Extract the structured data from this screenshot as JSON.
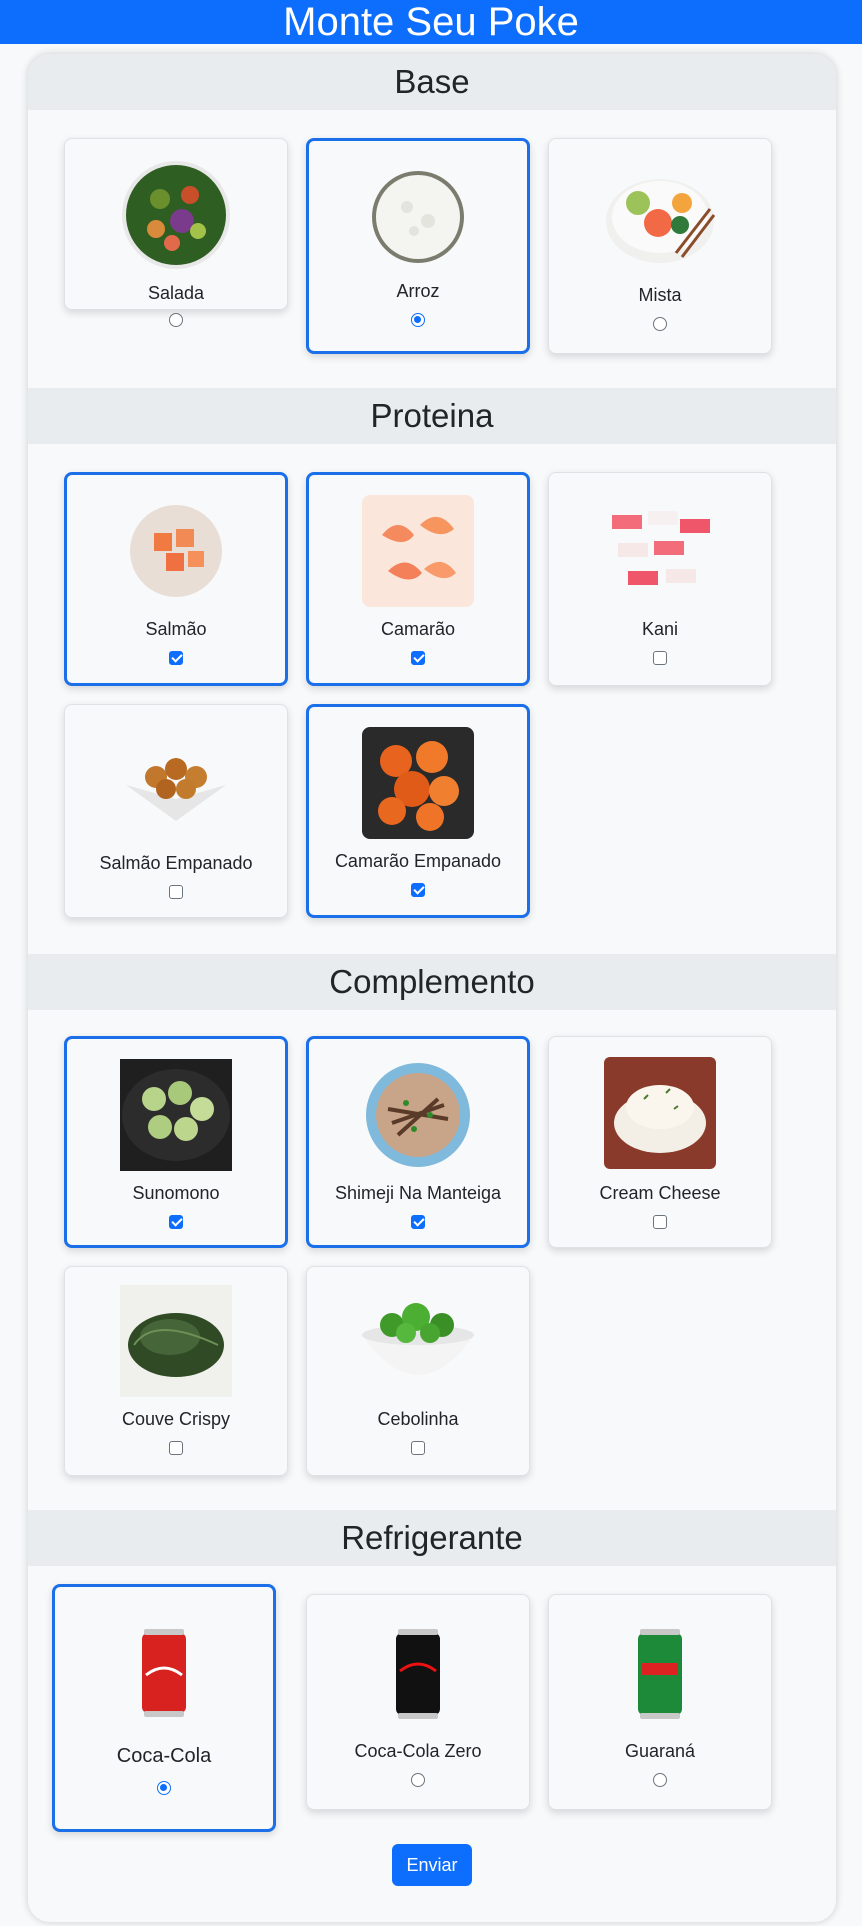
{
  "header": {
    "title": "Monte Seu Poke"
  },
  "sections": {
    "base": {
      "title": "Base",
      "items": [
        {
          "label": "Salada",
          "selected": false
        },
        {
          "label": "Arroz",
          "selected": true
        },
        {
          "label": "Mista",
          "selected": false
        }
      ]
    },
    "proteina": {
      "title": "Proteina",
      "items": [
        {
          "label": "Salmão",
          "selected": true
        },
        {
          "label": "Camarão",
          "selected": true
        },
        {
          "label": "Kani",
          "selected": false
        },
        {
          "label": "Salmão Empanado",
          "selected": false
        },
        {
          "label": "Camarão Empanado",
          "selected": true
        }
      ]
    },
    "complemento": {
      "title": "Complemento",
      "items": [
        {
          "label": "Sunomono",
          "selected": true
        },
        {
          "label": "Shimeji Na Manteiga",
          "selected": true
        },
        {
          "label": "Cream Cheese",
          "selected": false
        },
        {
          "label": "Couve Crispy",
          "selected": false
        },
        {
          "label": "Cebolinha",
          "selected": false
        }
      ]
    },
    "refrigerante": {
      "title": "Refrigerante",
      "items": [
        {
          "label": "Coca-Cola",
          "selected": true
        },
        {
          "label": "Coca-Cola Zero",
          "selected": false
        },
        {
          "label": "Guaraná",
          "selected": false
        }
      ]
    }
  },
  "submit_label": "Enviar",
  "colors": {
    "accent": "#0d6efd",
    "selected_border": "#1b6fe8",
    "section_header": "#e9ecef"
  },
  "icons": {
    "salada": "salad-bowl-icon",
    "arroz": "rice-bowl-icon",
    "mista": "poke-bowl-icon",
    "salmao": "salmon-cubes-icon",
    "camarao": "shrimp-icon",
    "kani": "crab-stick-icon",
    "salmao_empanado": "breaded-salmon-icon",
    "camarao_empanado": "breaded-shrimp-icon",
    "sunomono": "cucumber-salad-icon",
    "shimeji": "mushroom-bowl-icon",
    "cream_cheese": "cream-cheese-icon",
    "couve": "crispy-kale-icon",
    "cebolinha": "green-onion-bowl-icon",
    "coca": "coca-cola-can-icon",
    "coca_zero": "coca-cola-zero-can-icon",
    "guarana": "guarana-can-icon"
  }
}
